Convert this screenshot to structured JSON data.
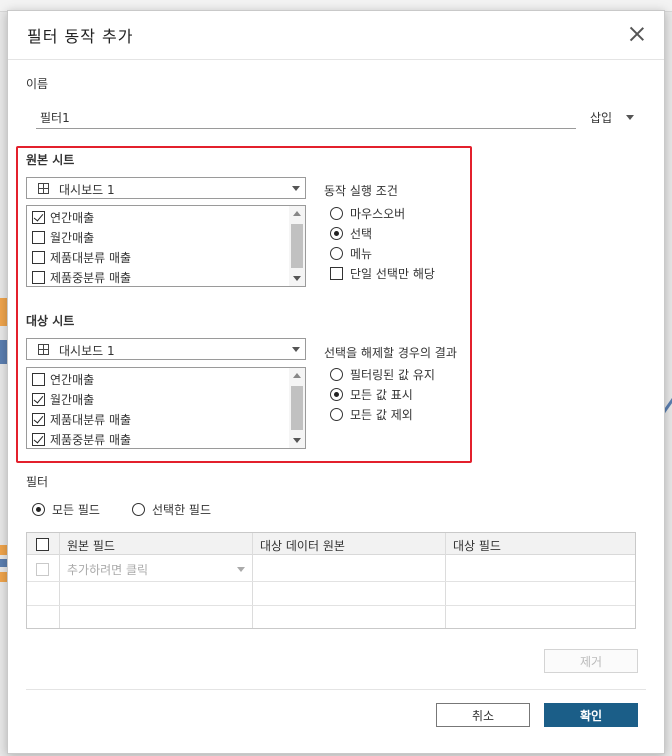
{
  "dialog": {
    "title": "필터 동작 추가",
    "name_label": "이름",
    "name_value": "필터1",
    "insert_label": "삽입"
  },
  "source": {
    "label": "원본 시트",
    "selected_sheet": "대시보드 1",
    "items": [
      {
        "label": "연간매출",
        "checked": true
      },
      {
        "label": "월간매출",
        "checked": false
      },
      {
        "label": "제품대분류 매출",
        "checked": false
      },
      {
        "label": "제품중분류 매출",
        "checked": false
      }
    ]
  },
  "trigger": {
    "label": "동작 실행 조건",
    "options": [
      "마우스오버",
      "선택",
      "메뉴"
    ],
    "selected": 1,
    "single_select_label": "단일 선택만 해당"
  },
  "target": {
    "label": "대상 시트",
    "selected_sheet": "대시보드 1",
    "items": [
      {
        "label": "연간매출",
        "checked": false
      },
      {
        "label": "월간매출",
        "checked": true
      },
      {
        "label": "제품대분류 매출",
        "checked": true
      },
      {
        "label": "제품중분류 매출",
        "checked": true
      }
    ]
  },
  "clearing": {
    "label": "선택을 해제할 경우의 결과",
    "options": [
      "필터링된 값 유지",
      "모든 값 표시",
      "모든 값 제외"
    ],
    "selected": 1
  },
  "filter": {
    "label": "필터",
    "all_fields": "모든 필드",
    "selected_fields": "선택한 필드",
    "selected": 0,
    "columns": [
      "원본 필드",
      "대상 데이터 원본",
      "대상 필드"
    ],
    "add_placeholder": "추가하려면 클릭"
  },
  "buttons": {
    "remove": "제거",
    "cancel": "취소",
    "ok": "확인"
  },
  "colors": {
    "highlight": "#e3202c",
    "primary": "#1b5e88"
  }
}
